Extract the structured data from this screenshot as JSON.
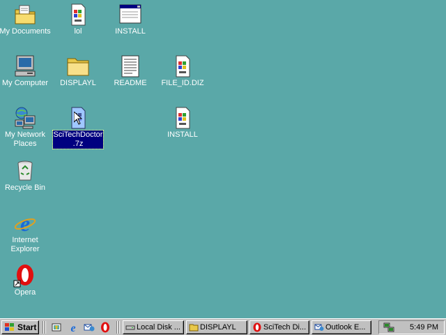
{
  "desktop": {
    "background": "#5aa8a8",
    "icons": [
      {
        "id": "my-documents",
        "label": "My Documents",
        "icon": "folder-documents-icon"
      },
      {
        "id": "lol",
        "label": "lol",
        "icon": "ini-file-icon"
      },
      {
        "id": "install-exe",
        "label": "INSTALL",
        "icon": "window-program-icon"
      },
      {
        "id": "my-computer",
        "label": "My Computer",
        "icon": "computer-icon"
      },
      {
        "id": "displayl",
        "label": "DISPLAYL",
        "icon": "folder-icon"
      },
      {
        "id": "readme",
        "label": "README",
        "icon": "text-document-icon"
      },
      {
        "id": "file-id-diz",
        "label": "FILE_ID.DIZ",
        "icon": "ini-file-icon"
      },
      {
        "id": "my-network-places",
        "label": "My Network\nPlaces",
        "icon": "network-icon"
      },
      {
        "id": "scitechdoctor",
        "label": "SciTechDoctor\n.7z",
        "icon": "unknown-file-icon",
        "selected": true
      },
      {
        "id": "install-ini",
        "label": "INSTALL",
        "icon": "ini-file-icon"
      },
      {
        "id": "recycle-bin",
        "label": "Recycle Bin",
        "icon": "recycle-bin-icon"
      },
      {
        "id": "internet-explorer",
        "label": "Internet\nExplorer",
        "icon": "ie-icon"
      },
      {
        "id": "opera",
        "label": "Opera",
        "icon": "opera-icon"
      }
    ]
  },
  "taskbar": {
    "start_label": "Start",
    "quick_launch": [
      "show-desktop-icon",
      "ie-icon",
      "outlook-express-icon",
      "opera-icon"
    ],
    "tasks": [
      {
        "label": "Local Disk ...",
        "icon": "drive-icon",
        "active": false
      },
      {
        "label": "DISPLAYL",
        "icon": "folder-icon",
        "active": false
      },
      {
        "label": "SciTech Di...",
        "icon": "opera-icon",
        "active": false
      },
      {
        "label": "Outlook E...",
        "icon": "outlook-express-icon",
        "active": false
      }
    ],
    "tray": {
      "clock": "5:49 PM",
      "icons": [
        "network-tray-icon"
      ]
    }
  }
}
